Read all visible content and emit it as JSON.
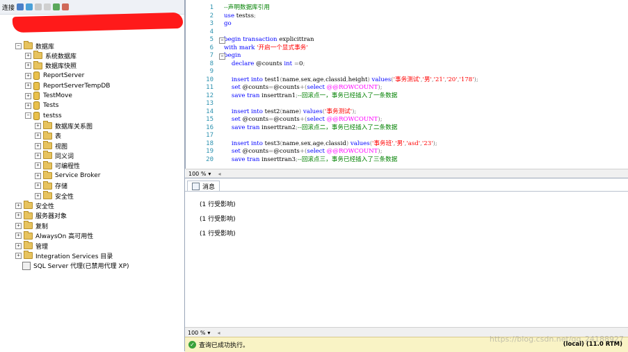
{
  "explorer": {
    "connect_label": "连接",
    "nodes": [
      {
        "label": "数据库"
      },
      {
        "label": "系统数据库"
      },
      {
        "label": "数据库快照"
      },
      {
        "label": "ReportServer"
      },
      {
        "label": "ReportServerTempDB"
      },
      {
        "label": "TestMove"
      },
      {
        "label": "Tests"
      },
      {
        "label": "testss"
      },
      {
        "label": "数据库关系图"
      },
      {
        "label": "表"
      },
      {
        "label": "视图"
      },
      {
        "label": "同义词"
      },
      {
        "label": "可编程性"
      },
      {
        "label": "Service Broker"
      },
      {
        "label": "存储"
      },
      {
        "label": "安全性"
      },
      {
        "label": "安全性"
      },
      {
        "label": "服务器对象"
      },
      {
        "label": "复制"
      },
      {
        "label": "AlwaysOn 高可用性"
      },
      {
        "label": "管理"
      },
      {
        "label": "Integration Services 目录"
      },
      {
        "label": "SQL Server 代理(已禁用代理 XP)"
      }
    ]
  },
  "editor": {
    "line_numbers": [
      "1",
      "2",
      "3",
      "4",
      "5",
      "6",
      "7",
      "8",
      "9",
      "10",
      "11",
      "12",
      "13",
      "14",
      "15",
      "16",
      "17",
      "18",
      "19",
      "20"
    ],
    "zoom": "100 %",
    "lines": [
      [
        {
          "t": "--声明数据库引用",
          "c": "cm"
        }
      ],
      [
        {
          "t": "use ",
          "c": "kw"
        },
        {
          "t": "testss",
          "c": "bl"
        },
        {
          "t": ";",
          "c": "gy"
        }
      ],
      [
        {
          "t": "go",
          "c": "kw"
        }
      ],
      [],
      [
        {
          "t": "begin transaction ",
          "c": "kw"
        },
        {
          "t": "explicittran",
          "c": "bl"
        }
      ],
      [
        {
          "t": "with mark ",
          "c": "kw"
        },
        {
          "t": "'开启一个显式事务'",
          "c": "st"
        }
      ],
      [
        {
          "t": "begin",
          "c": "kw"
        }
      ],
      [
        {
          "t": "    declare ",
          "c": "kw"
        },
        {
          "t": "@counts ",
          "c": "bl"
        },
        {
          "t": "int ",
          "c": "kw"
        },
        {
          "t": "=",
          "c": "gy"
        },
        {
          "t": "0",
          "c": "bl"
        },
        {
          "t": ";",
          "c": "gy"
        }
      ],
      [],
      [
        {
          "t": "    insert into ",
          "c": "kw"
        },
        {
          "t": "test1",
          "c": "bl"
        },
        {
          "t": "(",
          "c": "gy"
        },
        {
          "t": "name",
          "c": "bl"
        },
        {
          "t": ",",
          "c": "gy"
        },
        {
          "t": "sex",
          "c": "bl"
        },
        {
          "t": ",",
          "c": "gy"
        },
        {
          "t": "age",
          "c": "bl"
        },
        {
          "t": ",",
          "c": "gy"
        },
        {
          "t": "classid",
          "c": "bl"
        },
        {
          "t": ",",
          "c": "gy"
        },
        {
          "t": "height",
          "c": "bl"
        },
        {
          "t": ") ",
          "c": "gy"
        },
        {
          "t": "values",
          "c": "kw"
        },
        {
          "t": "(",
          "c": "gy"
        },
        {
          "t": "'事务测试'",
          "c": "st"
        },
        {
          "t": ",",
          "c": "gy"
        },
        {
          "t": "'男'",
          "c": "st"
        },
        {
          "t": ",",
          "c": "gy"
        },
        {
          "t": "'21'",
          "c": "st"
        },
        {
          "t": ",",
          "c": "gy"
        },
        {
          "t": "'20'",
          "c": "st"
        },
        {
          "t": ",",
          "c": "gy"
        },
        {
          "t": "'178'",
          "c": "st"
        },
        {
          "t": ");",
          "c": "gy"
        }
      ],
      [
        {
          "t": "    set ",
          "c": "kw"
        },
        {
          "t": "@counts",
          "c": "bl"
        },
        {
          "t": "=",
          "c": "gy"
        },
        {
          "t": "@counts",
          "c": "bl"
        },
        {
          "t": "+(",
          "c": "gy"
        },
        {
          "t": "select ",
          "c": "kw"
        },
        {
          "t": "@@ROWCOUNT",
          "c": "mg"
        },
        {
          "t": ");",
          "c": "gy"
        }
      ],
      [
        {
          "t": "    save tran ",
          "c": "kw"
        },
        {
          "t": "inserttran1",
          "c": "bl"
        },
        {
          "t": ";",
          "c": "gy"
        },
        {
          "t": "--回滚点一，事务已经插入了一条数据",
          "c": "cm"
        }
      ],
      [],
      [
        {
          "t": "    insert into ",
          "c": "kw"
        },
        {
          "t": "test2",
          "c": "bl"
        },
        {
          "t": "(",
          "c": "gy"
        },
        {
          "t": "name",
          "c": "bl"
        },
        {
          "t": ") ",
          "c": "gy"
        },
        {
          "t": "values",
          "c": "kw"
        },
        {
          "t": "(",
          "c": "gy"
        },
        {
          "t": "'事务测试'",
          "c": "st"
        },
        {
          "t": ");",
          "c": "gy"
        }
      ],
      [
        {
          "t": "    set ",
          "c": "kw"
        },
        {
          "t": "@counts",
          "c": "bl"
        },
        {
          "t": "=",
          "c": "gy"
        },
        {
          "t": "@counts",
          "c": "bl"
        },
        {
          "t": "+(",
          "c": "gy"
        },
        {
          "t": "select ",
          "c": "kw"
        },
        {
          "t": "@@ROWCOUNT",
          "c": "mg"
        },
        {
          "t": ");",
          "c": "gy"
        }
      ],
      [
        {
          "t": "    save tran ",
          "c": "kw"
        },
        {
          "t": "inserttran2",
          "c": "bl"
        },
        {
          "t": ";",
          "c": "gy"
        },
        {
          "t": "--回滚点二，事务已经插入了二条数据",
          "c": "cm"
        }
      ],
      [],
      [
        {
          "t": "    insert into ",
          "c": "kw"
        },
        {
          "t": "test3",
          "c": "bl"
        },
        {
          "t": "(",
          "c": "gy"
        },
        {
          "t": "name",
          "c": "bl"
        },
        {
          "t": ",",
          "c": "gy"
        },
        {
          "t": "sex",
          "c": "bl"
        },
        {
          "t": ",",
          "c": "gy"
        },
        {
          "t": "age",
          "c": "bl"
        },
        {
          "t": ",",
          "c": "gy"
        },
        {
          "t": "classid",
          "c": "bl"
        },
        {
          "t": ") ",
          "c": "gy"
        },
        {
          "t": "values",
          "c": "kw"
        },
        {
          "t": "(",
          "c": "gy"
        },
        {
          "t": "'事务班'",
          "c": "st"
        },
        {
          "t": ",",
          "c": "gy"
        },
        {
          "t": "'男'",
          "c": "st"
        },
        {
          "t": ",",
          "c": "gy"
        },
        {
          "t": "'asd'",
          "c": "st"
        },
        {
          "t": ",",
          "c": "gy"
        },
        {
          "t": "'23'",
          "c": "st"
        },
        {
          "t": ");",
          "c": "gy"
        }
      ],
      [
        {
          "t": "    set ",
          "c": "kw"
        },
        {
          "t": "@counts",
          "c": "bl"
        },
        {
          "t": "=",
          "c": "gy"
        },
        {
          "t": "@counts",
          "c": "bl"
        },
        {
          "t": "+(",
          "c": "gy"
        },
        {
          "t": "select ",
          "c": "kw"
        },
        {
          "t": "@@ROWCOUNT",
          "c": "mg"
        },
        {
          "t": ");",
          "c": "gy"
        }
      ],
      [
        {
          "t": "    save tran ",
          "c": "kw"
        },
        {
          "t": "inserttran3",
          "c": "bl"
        },
        {
          "t": ";",
          "c": "gy"
        },
        {
          "t": "--回滚点三，事务已经插入了三条数据",
          "c": "cm"
        }
      ]
    ]
  },
  "results": {
    "tab_label": "消息",
    "messages": [
      "(1 行受影响)",
      "(1 行受影响)",
      "(1 行受影响)"
    ],
    "zoom": "100 %"
  },
  "status": {
    "text": "查询已成功执行。",
    "server": "(local) (11.0 RTM)",
    "watermark": "https://blog.csdn.net/qq_24188927"
  }
}
